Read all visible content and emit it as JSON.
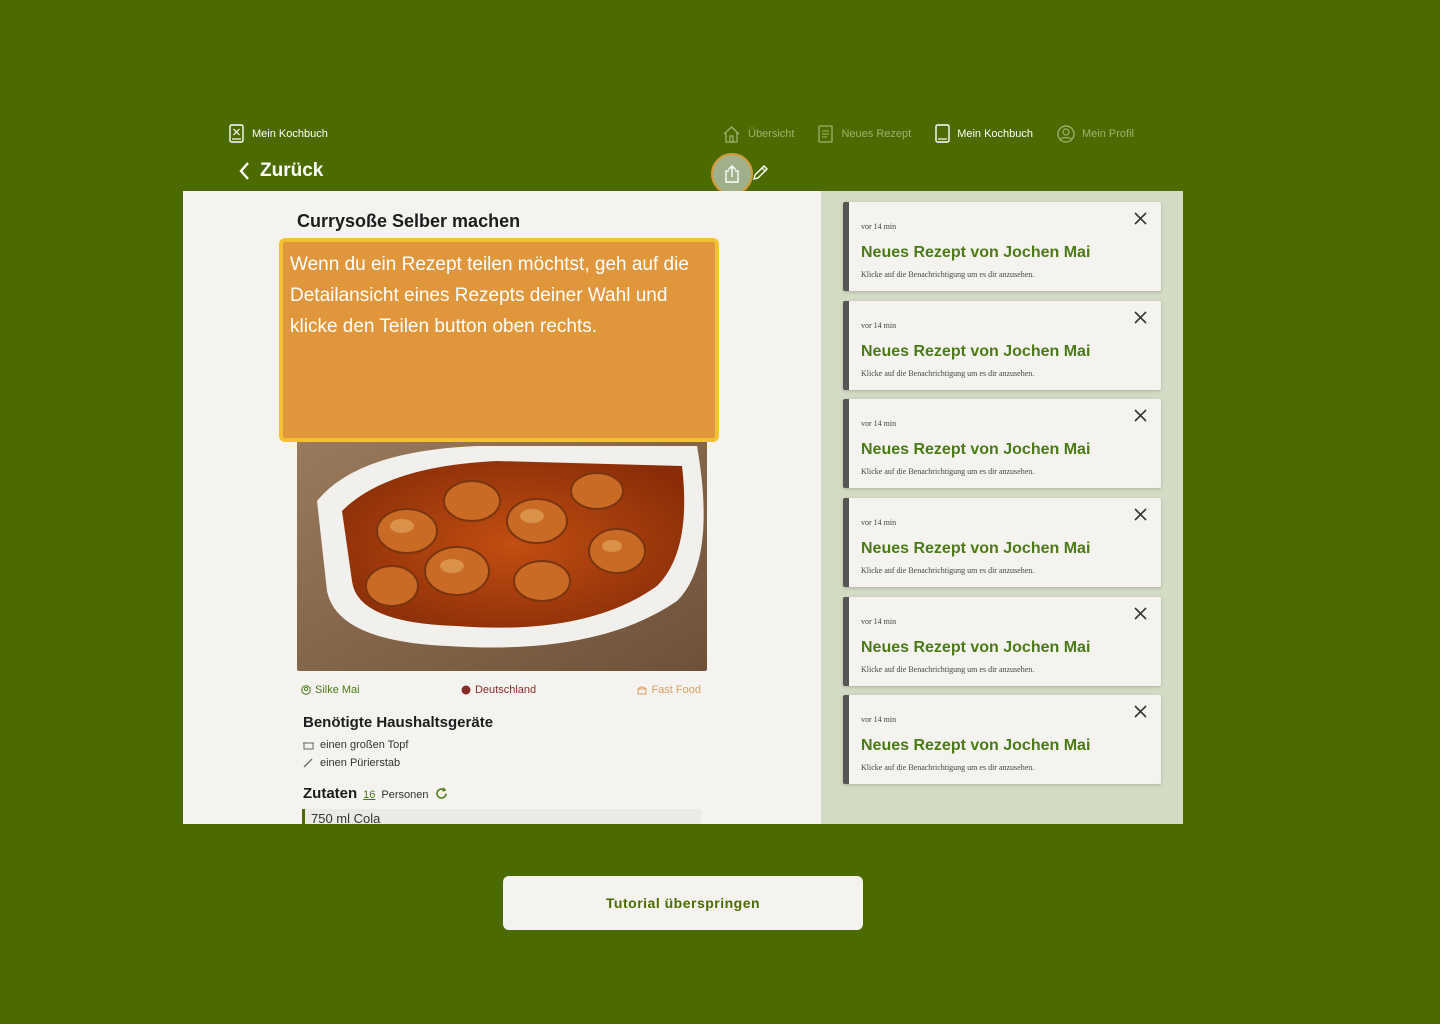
{
  "brand": {
    "label": "Mein Kochbuch"
  },
  "nav": {
    "items": [
      {
        "label": "Übersicht",
        "icon": "home-icon"
      },
      {
        "label": "Neues Rezept",
        "icon": "document-icon"
      },
      {
        "label": "Mein Kochbuch",
        "icon": "book-icon",
        "active": true
      },
      {
        "label": "Mein Profil",
        "icon": "profile-icon"
      }
    ]
  },
  "back": {
    "label": "Zurück"
  },
  "recipe": {
    "title": "Currysoße Selber machen",
    "author": "Silke Mai",
    "country": "Deutschland",
    "category": "Fast Food",
    "tools_heading": "Benötigte Haushaltsgeräte",
    "tools": [
      "einen großen Topf",
      "einen Pürierstab"
    ],
    "ingredients_heading": "Zutaten",
    "persons_count": "16",
    "persons_label": "Personen",
    "ingredients": [
      "750 ml Cola"
    ]
  },
  "tooltip": {
    "text": "Wenn du ein Rezept teilen möchtst, geh auf die Detailansicht eines Rezepts deiner Wahl und klicke den Teilen button oben rechts."
  },
  "notifications": [
    {
      "time": "vor 14 min",
      "title": "Neues Rezept von Jochen Mai",
      "text": "Klicke auf die Benachrichtigung um es dir anzusehen."
    },
    {
      "time": "vor 14 min",
      "title": "Neues Rezept von Jochen Mai",
      "text": "Klicke auf die Benachrichtigung um es dir anzusehen."
    },
    {
      "time": "vor 14 min",
      "title": "Neues Rezept von Jochen Mai",
      "text": "Klicke auf die Benachrichtigung um es dir anzusehen."
    },
    {
      "time": "vor 14 min",
      "title": "Neues Rezept von Jochen Mai",
      "text": "Klicke auf die Benachrichtigung um es dir anzusehen."
    },
    {
      "time": "vor 14 min",
      "title": "Neues Rezept von Jochen Mai",
      "text": "Klicke auf die Benachrichtigung um es dir anzusehen."
    },
    {
      "time": "vor 14 min",
      "title": "Neues Rezept von Jochen Mai",
      "text": "Klicke auf die Benachrichtigung um es dir anzusehen."
    }
  ],
  "skip": {
    "label": "Tutorial überspringen"
  },
  "colors": {
    "background": "#4b6b00",
    "accent": "#4b7a16",
    "tooltip": "#e0963b",
    "tooltip_border": "#f2c232"
  }
}
